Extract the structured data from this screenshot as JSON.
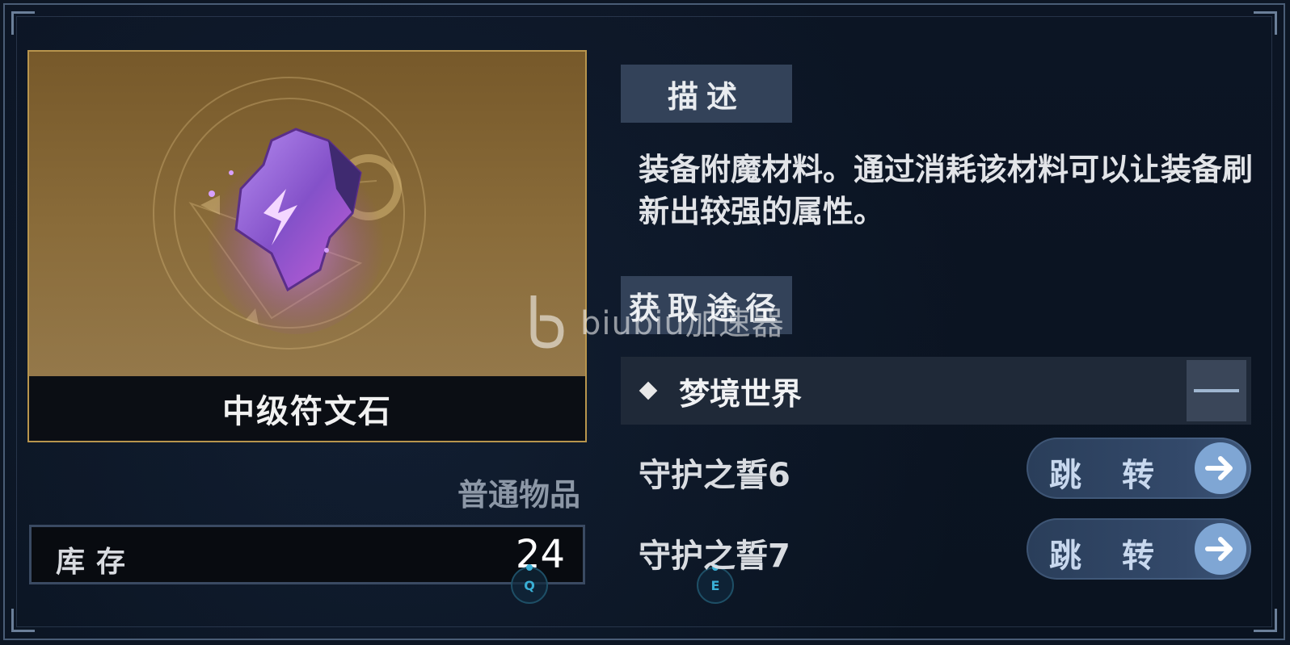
{
  "item": {
    "name": "中级符文石",
    "rarity": "普通物品",
    "stock_label": "库存",
    "stock_value": "24"
  },
  "key_hints": {
    "left": "Q",
    "right": "E"
  },
  "description": {
    "header": "描述",
    "text": "装备附魔材料。通过消耗该材料可以让装备刷新出较强的属性。"
  },
  "acquisition": {
    "header": "获取途径",
    "source": "梦境世界",
    "levels": [
      {
        "name": "守护之誓6",
        "action": "跳转"
      },
      {
        "name": "守护之誓7",
        "action": "跳转"
      }
    ]
  },
  "watermark": "biubiu加速器",
  "colors": {
    "card_border": "#b8954d",
    "image_bg": "#8a6c3a",
    "header_bg": "#334259",
    "jump_arrow": "#7fa6d4",
    "key_hint": "#3ab0d6"
  },
  "icons": [
    "rune-stone-icon",
    "diamond-bullet-icon",
    "collapse-icon",
    "arrow-right-icon",
    "biubiu-logo-icon"
  ]
}
